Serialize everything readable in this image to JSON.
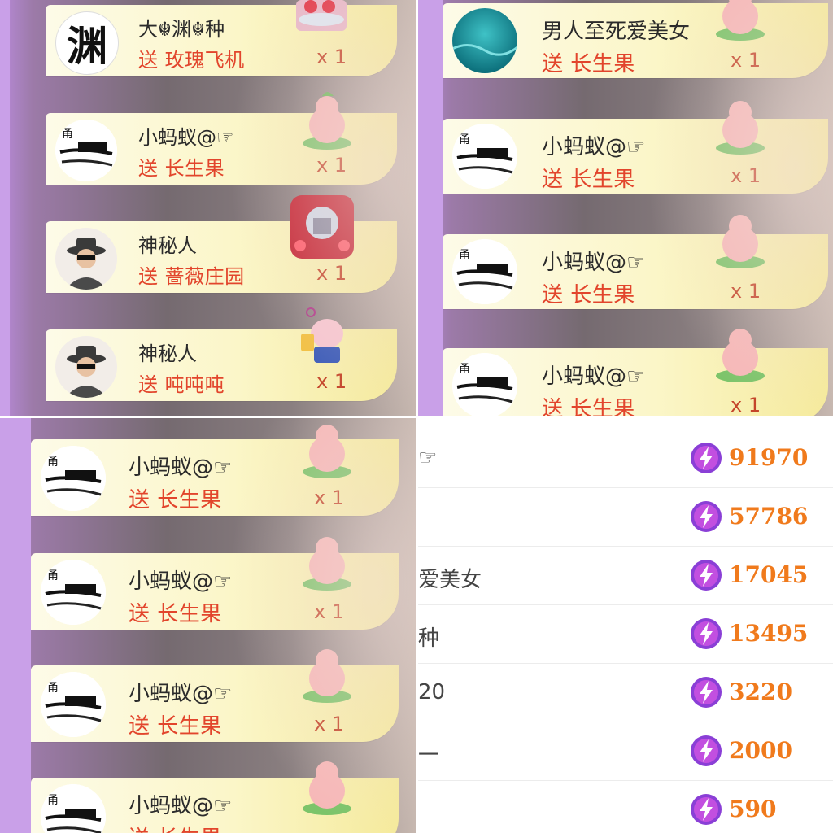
{
  "colors": {
    "name_text": "#2b2b2b",
    "gift_text": "#e2452c",
    "score_text": "#f07a1c",
    "bolt": "#8a3fd6",
    "row_bg": "#fbf6c8"
  },
  "panels": {
    "top_left": {
      "rows": [
        {
          "avatar": "yuan-char-avatar",
          "avatar_text": "渊",
          "name": "大☬渊☬种",
          "gift": "送 玫瑰飞机",
          "count": "x 1",
          "gift_icon": "rose-airplane-gift-icon"
        },
        {
          "avatar": "ink-boat-avatar",
          "name": "小蚂蚁@☞",
          "gift": "送 长生果",
          "count": "x 1",
          "gift_icon": "longevity-fruit-gift-icon"
        },
        {
          "avatar": "hat-man-avatar",
          "name": "神秘人",
          "gift": "送 蔷薇庄园",
          "count": "x 1",
          "gift_icon": "rose-manor-gift-icon"
        },
        {
          "avatar": "hat-man-avatar",
          "name": "神秘人",
          "gift": "送 吨吨吨",
          "count": "x 1",
          "gift_icon": "pig-beer-gift-icon"
        }
      ]
    },
    "top_right": {
      "rows": [
        {
          "avatar": "ocean-avatar",
          "name": "男人至死爱美女",
          "gift": "送 长生果",
          "count": "x 1",
          "gift_icon": "longevity-fruit-gift-icon"
        },
        {
          "avatar": "ink-boat-avatar",
          "name": "小蚂蚁@☞",
          "gift": "送 长生果",
          "count": "x 1",
          "gift_icon": "longevity-fruit-gift-icon"
        },
        {
          "avatar": "ink-boat-avatar",
          "name": "小蚂蚁@☞",
          "gift": "送 长生果",
          "count": "x 1",
          "gift_icon": "longevity-fruit-gift-icon"
        },
        {
          "avatar": "ink-boat-avatar",
          "name": "小蚂蚁@☞",
          "gift": "送 长生果",
          "count": "x 1",
          "gift_icon": "longevity-fruit-gift-icon"
        }
      ]
    },
    "bottom_left": {
      "rows": [
        {
          "avatar": "ink-boat-avatar",
          "name": "小蚂蚁@☞",
          "gift": "送 长生果",
          "count": "x 1",
          "gift_icon": "longevity-fruit-gift-icon"
        },
        {
          "avatar": "ink-boat-avatar",
          "name": "小蚂蚁@☞",
          "gift": "送 长生果",
          "count": "x 1",
          "gift_icon": "longevity-fruit-gift-icon"
        },
        {
          "avatar": "ink-boat-avatar",
          "name": "小蚂蚁@☞",
          "gift": "送 长生果",
          "count": "x 1",
          "gift_icon": "longevity-fruit-gift-icon"
        },
        {
          "avatar": "ink-boat-avatar",
          "name": "小蚂蚁@☞",
          "gift": "送 长生果",
          "count": "",
          "gift_icon": "longevity-fruit-gift-icon"
        }
      ]
    }
  },
  "ranking": {
    "rows": [
      {
        "name": "☞",
        "score": "91970"
      },
      {
        "name": "",
        "score": "57786"
      },
      {
        "name": "爱美女",
        "score": "17045"
      },
      {
        "name": "种",
        "score": "13495"
      },
      {
        "name": "20",
        "score": "3220"
      },
      {
        "name": "一",
        "score": "2000"
      },
      {
        "name": "",
        "score": "590"
      }
    ]
  }
}
